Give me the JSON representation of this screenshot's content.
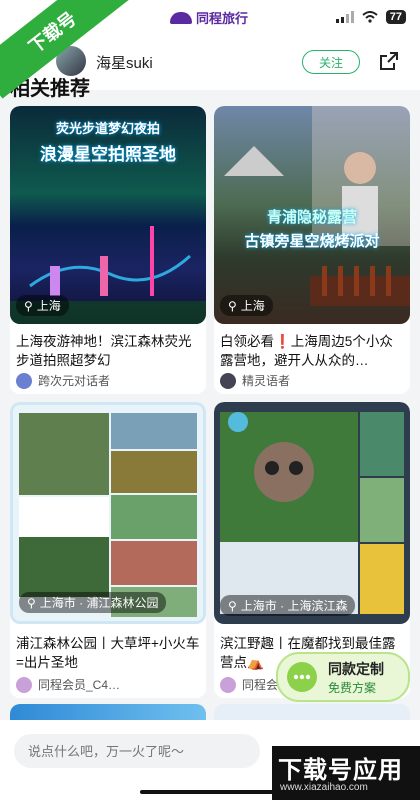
{
  "watermark_corner": "下载号",
  "status_bar": {
    "brand": "同程旅行",
    "battery": "77"
  },
  "header": {
    "username": "海星suki",
    "follow_label": "关注"
  },
  "section_title": "相关推荐",
  "cards": [
    {
      "overlay_line1": "荧光步道梦幻夜拍",
      "overlay_line2": "浪漫星空拍照圣地",
      "location": "上海",
      "title": "上海夜游神地！滨江森林荧光步道拍照超梦幻",
      "author": "跨次元对话者"
    },
    {
      "overlay_line1": "青浦隐秘露营",
      "overlay_line2": "古镇旁星空烧烤派对",
      "location": "上海",
      "title": "白领必看❗上海周边5个小众露营地，避开人从众的…",
      "author": "精灵语者"
    },
    {
      "location": "上海市 · 浦江森林公园",
      "title": "浦江森林公园丨大草坪+小火车=出片圣地",
      "author": "同程会员_C4…"
    },
    {
      "location": "上海市 · 上海滨江森",
      "title": "滨江野趣丨在魔都找到最佳露营点⛺",
      "author": "同程会"
    }
  ],
  "promo": {
    "main": "同款定制",
    "sub": "免费方案"
  },
  "comment_input": {
    "placeholder": "说点什么吧，万一火了呢～"
  },
  "watermark_br": {
    "main": "下载号应用",
    "url": "www.xiazaihao.com"
  },
  "colors": {
    "accent_green": "#27b36c",
    "brand_purple": "#5b2aa0"
  }
}
